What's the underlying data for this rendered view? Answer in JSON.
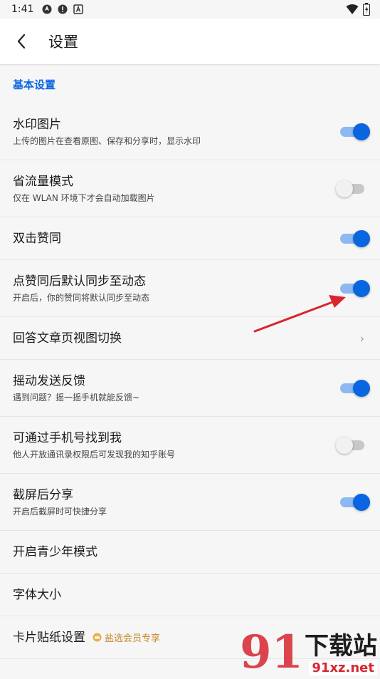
{
  "status_bar": {
    "time": "1:41",
    "left_icons": [
      "navigation-icon",
      "alert-icon",
      "a-icon"
    ],
    "right_icons": [
      "wifi-icon",
      "battery-icon"
    ]
  },
  "header": {
    "title": "设置"
  },
  "section": {
    "label": "基本设置"
  },
  "rows": [
    {
      "title": "水印图片",
      "subtitle": "上传的图片在查看原图、保存和分享时，显示水印",
      "control": "toggle",
      "on": true
    },
    {
      "title": "省流量模式",
      "subtitle": "仅在 WLAN 环境下才会自动加载图片",
      "control": "toggle",
      "on": false
    },
    {
      "title": "双击赞同",
      "subtitle": "",
      "control": "toggle",
      "on": true
    },
    {
      "title": "点赞同后默认同步至动态",
      "subtitle": "开启后，你的赞同将默认同步至动态",
      "control": "toggle",
      "on": true
    },
    {
      "title": "回答文章页视图切换",
      "subtitle": "",
      "control": "chevron",
      "chevron": "›"
    },
    {
      "title": "摇动发送反馈",
      "subtitle": "遇到问题？摇一摇手机就能反馈~",
      "control": "toggle",
      "on": true
    },
    {
      "title": "可通过手机号找到我",
      "subtitle": "他人开放通讯录权限后可发现我的知乎账号",
      "control": "toggle",
      "on": false
    },
    {
      "title": "截屏后分享",
      "subtitle": "开启后截屏时可快捷分享",
      "control": "toggle",
      "on": true
    },
    {
      "title": "开启青少年模式",
      "subtitle": "",
      "control": "none"
    },
    {
      "title": "字体大小",
      "subtitle": "",
      "control": "none"
    },
    {
      "title": "卡片贴纸设置",
      "subtitle": "",
      "control": "badge",
      "badge": "盐选会员专享"
    }
  ],
  "watermark": {
    "number": "91",
    "cn": "下载站",
    "url": "91xz.net"
  },
  "colors": {
    "accent": "#0a66e0",
    "toggle_on_track": "#8db8f0",
    "toggle_off_track": "#c8c8c8",
    "annotation_arrow": "#d8262f"
  }
}
